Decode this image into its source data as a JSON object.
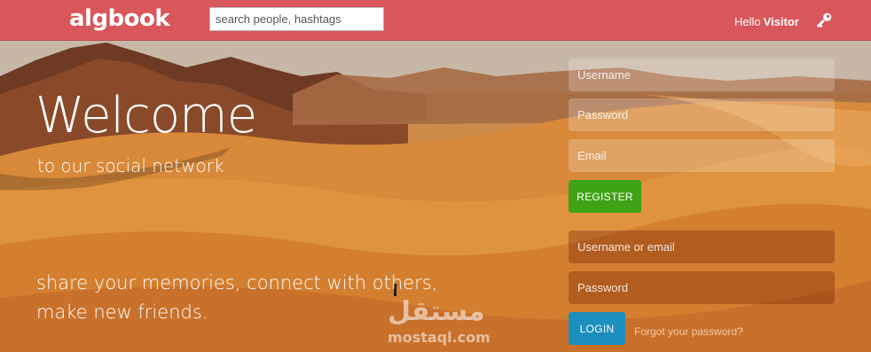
{
  "header": {
    "logo": "algbook",
    "search_placeholder": "search people, hashtags",
    "greeting": "Hello",
    "username": "Visitor",
    "login_icon": "key-icon",
    "background_color": "#d9575a"
  },
  "hero": {
    "title": "Welcome",
    "subtitle": "to our social network",
    "tagline_line1": "share your memories, connect with others,",
    "tagline_line2": "make new friends."
  },
  "register_form": {
    "username_placeholder": "Username",
    "password_placeholder": "Password",
    "email_placeholder": "Email",
    "button_label": "REGISTER",
    "button_color": "#3fa316"
  },
  "login_form": {
    "username_placeholder": "Username or email",
    "password_placeholder": "Password",
    "button_label": "LOGIN",
    "button_color": "#1b8fbd",
    "forgot_link": "Forgot your password?"
  },
  "watermark": {
    "arabic": "مستقل",
    "latin": "mostaql.com"
  }
}
